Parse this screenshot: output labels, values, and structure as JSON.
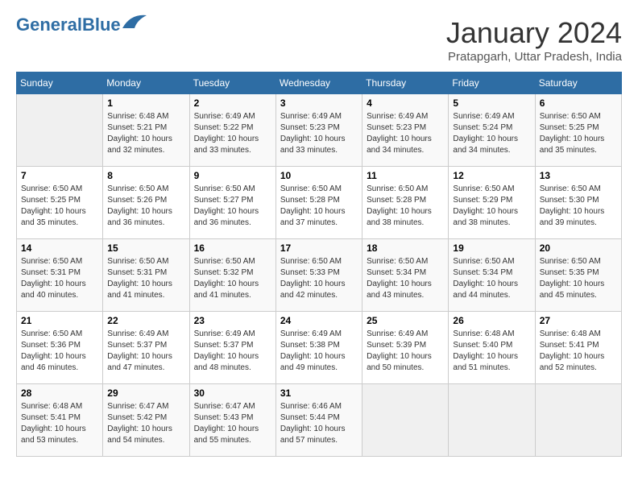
{
  "header": {
    "logo_general": "General",
    "logo_blue": "Blue",
    "month_title": "January 2024",
    "subtitle": "Pratapgarh, Uttar Pradesh, India"
  },
  "days_of_week": [
    "Sunday",
    "Monday",
    "Tuesday",
    "Wednesday",
    "Thursday",
    "Friday",
    "Saturday"
  ],
  "weeks": [
    [
      null,
      {
        "day": 1,
        "sunrise": "6:48 AM",
        "sunset": "5:21 PM",
        "daylight": "10 hours and 32 minutes."
      },
      {
        "day": 2,
        "sunrise": "6:49 AM",
        "sunset": "5:22 PM",
        "daylight": "10 hours and 33 minutes."
      },
      {
        "day": 3,
        "sunrise": "6:49 AM",
        "sunset": "5:23 PM",
        "daylight": "10 hours and 33 minutes."
      },
      {
        "day": 4,
        "sunrise": "6:49 AM",
        "sunset": "5:23 PM",
        "daylight": "10 hours and 34 minutes."
      },
      {
        "day": 5,
        "sunrise": "6:49 AM",
        "sunset": "5:24 PM",
        "daylight": "10 hours and 34 minutes."
      },
      {
        "day": 6,
        "sunrise": "6:50 AM",
        "sunset": "5:25 PM",
        "daylight": "10 hours and 35 minutes."
      }
    ],
    [
      {
        "day": 7,
        "sunrise": "6:50 AM",
        "sunset": "5:25 PM",
        "daylight": "10 hours and 35 minutes."
      },
      {
        "day": 8,
        "sunrise": "6:50 AM",
        "sunset": "5:26 PM",
        "daylight": "10 hours and 36 minutes."
      },
      {
        "day": 9,
        "sunrise": "6:50 AM",
        "sunset": "5:27 PM",
        "daylight": "10 hours and 36 minutes."
      },
      {
        "day": 10,
        "sunrise": "6:50 AM",
        "sunset": "5:28 PM",
        "daylight": "10 hours and 37 minutes."
      },
      {
        "day": 11,
        "sunrise": "6:50 AM",
        "sunset": "5:28 PM",
        "daylight": "10 hours and 38 minutes."
      },
      {
        "day": 12,
        "sunrise": "6:50 AM",
        "sunset": "5:29 PM",
        "daylight": "10 hours and 38 minutes."
      },
      {
        "day": 13,
        "sunrise": "6:50 AM",
        "sunset": "5:30 PM",
        "daylight": "10 hours and 39 minutes."
      }
    ],
    [
      {
        "day": 14,
        "sunrise": "6:50 AM",
        "sunset": "5:31 PM",
        "daylight": "10 hours and 40 minutes."
      },
      {
        "day": 15,
        "sunrise": "6:50 AM",
        "sunset": "5:31 PM",
        "daylight": "10 hours and 41 minutes."
      },
      {
        "day": 16,
        "sunrise": "6:50 AM",
        "sunset": "5:32 PM",
        "daylight": "10 hours and 41 minutes."
      },
      {
        "day": 17,
        "sunrise": "6:50 AM",
        "sunset": "5:33 PM",
        "daylight": "10 hours and 42 minutes."
      },
      {
        "day": 18,
        "sunrise": "6:50 AM",
        "sunset": "5:34 PM",
        "daylight": "10 hours and 43 minutes."
      },
      {
        "day": 19,
        "sunrise": "6:50 AM",
        "sunset": "5:34 PM",
        "daylight": "10 hours and 44 minutes."
      },
      {
        "day": 20,
        "sunrise": "6:50 AM",
        "sunset": "5:35 PM",
        "daylight": "10 hours and 45 minutes."
      }
    ],
    [
      {
        "day": 21,
        "sunrise": "6:50 AM",
        "sunset": "5:36 PM",
        "daylight": "10 hours and 46 minutes."
      },
      {
        "day": 22,
        "sunrise": "6:49 AM",
        "sunset": "5:37 PM",
        "daylight": "10 hours and 47 minutes."
      },
      {
        "day": 23,
        "sunrise": "6:49 AM",
        "sunset": "5:37 PM",
        "daylight": "10 hours and 48 minutes."
      },
      {
        "day": 24,
        "sunrise": "6:49 AM",
        "sunset": "5:38 PM",
        "daylight": "10 hours and 49 minutes."
      },
      {
        "day": 25,
        "sunrise": "6:49 AM",
        "sunset": "5:39 PM",
        "daylight": "10 hours and 50 minutes."
      },
      {
        "day": 26,
        "sunrise": "6:48 AM",
        "sunset": "5:40 PM",
        "daylight": "10 hours and 51 minutes."
      },
      {
        "day": 27,
        "sunrise": "6:48 AM",
        "sunset": "5:41 PM",
        "daylight": "10 hours and 52 minutes."
      }
    ],
    [
      {
        "day": 28,
        "sunrise": "6:48 AM",
        "sunset": "5:41 PM",
        "daylight": "10 hours and 53 minutes."
      },
      {
        "day": 29,
        "sunrise": "6:47 AM",
        "sunset": "5:42 PM",
        "daylight": "10 hours and 54 minutes."
      },
      {
        "day": 30,
        "sunrise": "6:47 AM",
        "sunset": "5:43 PM",
        "daylight": "10 hours and 55 minutes."
      },
      {
        "day": 31,
        "sunrise": "6:46 AM",
        "sunset": "5:44 PM",
        "daylight": "10 hours and 57 minutes."
      },
      null,
      null,
      null
    ]
  ]
}
